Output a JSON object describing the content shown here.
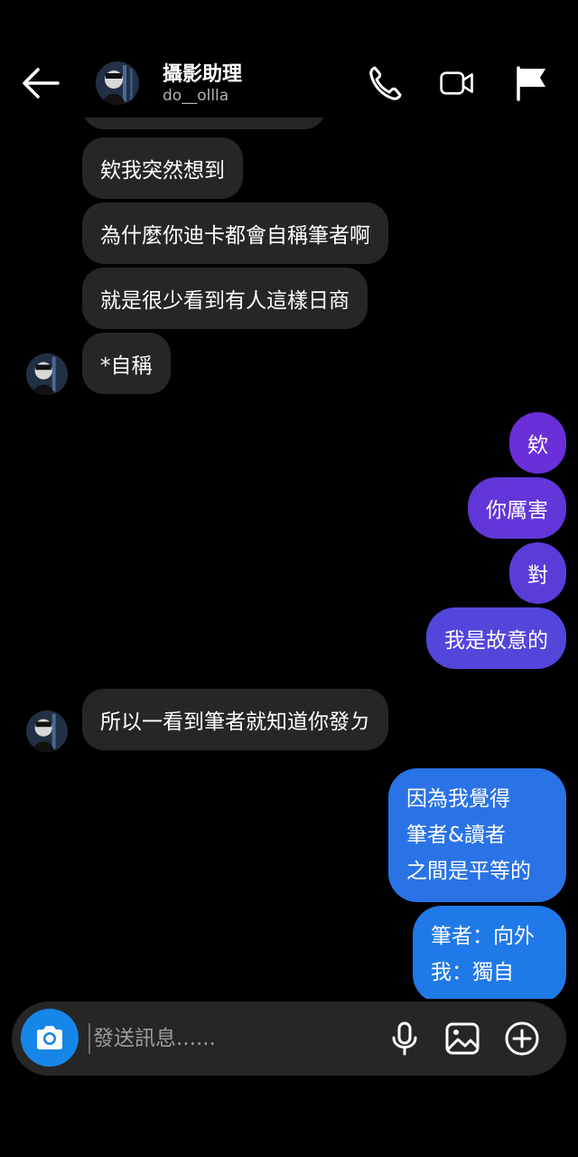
{
  "header": {
    "back_icon": "arrow-left-icon",
    "contact_name": "攝影助理",
    "contact_username": "do__ollla",
    "actions": [
      "phone-icon",
      "video-camera-icon",
      "flag-icon"
    ]
  },
  "messages": [
    {
      "from": "them",
      "text": "欸我突然想到"
    },
    {
      "from": "them",
      "text": "為什麼你迪卡都會自稱筆者啊"
    },
    {
      "from": "them",
      "text": "就是很少看到有人這樣日商"
    },
    {
      "from": "them",
      "text": "*自稱"
    },
    {
      "from": "me",
      "text": "欸"
    },
    {
      "from": "me",
      "text": "你厲害"
    },
    {
      "from": "me",
      "text": "對"
    },
    {
      "from": "me",
      "text": "我是故意的"
    },
    {
      "from": "them",
      "text": "所以一看到筆者就知道你發ㄉ"
    },
    {
      "from": "me",
      "lines": [
        "因為我覺得",
        "筆者&讀者",
        "之間是平等的"
      ]
    },
    {
      "from": "me",
      "lines": [
        "筆者：向外",
        "我：獨自"
      ]
    }
  ],
  "composer": {
    "placeholder": "發送訊息......",
    "camera_icon": "camera-icon",
    "icons": [
      "microphone-icon",
      "image-icon",
      "plus-circle-icon"
    ]
  },
  "colors": {
    "background": "#000000",
    "incoming_bubble": "#262626",
    "outgoing_gradient_top": "#7a2fd6",
    "outgoing_gradient_bottom": "#1f7ae8",
    "camera_button": "#1686e8"
  }
}
